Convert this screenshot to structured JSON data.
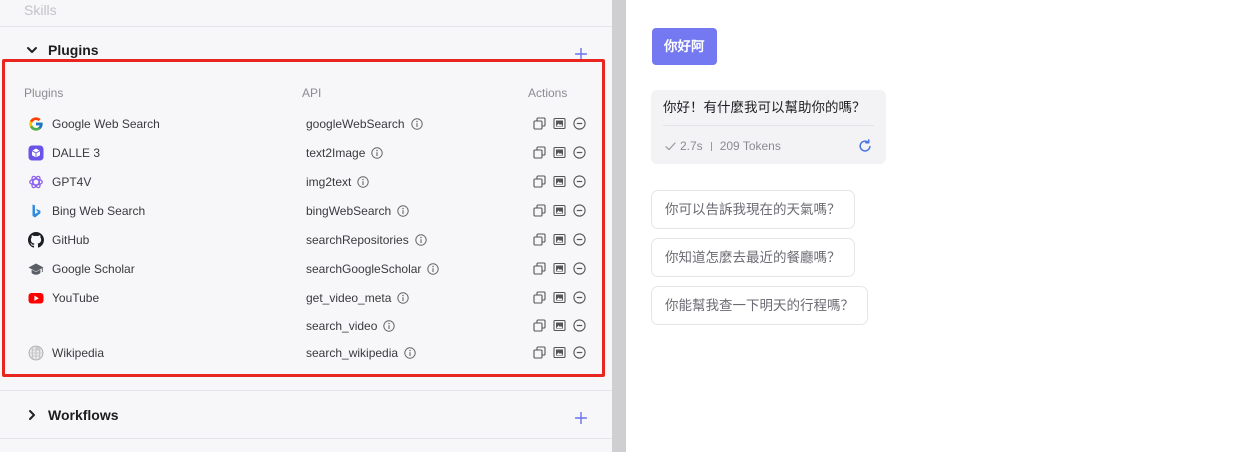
{
  "sidebar": {
    "skills_label": "Skills",
    "plugins": {
      "title": "Plugins",
      "headers": {
        "plugin": "Plugins",
        "api": "API",
        "actions": "Actions"
      },
      "rows": [
        {
          "plugin": "Google Web Search",
          "icon": "google-icon",
          "api": "googleWebSearch"
        },
        {
          "plugin": "DALLE 3",
          "icon": "dalle-icon",
          "api": "text2Image"
        },
        {
          "plugin": "GPT4V",
          "icon": "gpt4v-icon",
          "api": "img2text"
        },
        {
          "plugin": "Bing Web Search",
          "icon": "bing-icon",
          "api": "bingWebSearch"
        },
        {
          "plugin": "GitHub",
          "icon": "github-icon",
          "api": "searchRepositories"
        },
        {
          "plugin": "Google Scholar",
          "icon": "google-scholar-icon",
          "api": "searchGoogleScholar"
        },
        {
          "plugin": "YouTube",
          "icon": "youtube-icon",
          "api": "get_video_meta"
        },
        {
          "plugin": "",
          "icon": null,
          "api": "search_video"
        },
        {
          "plugin": "Wikipedia",
          "icon": "wikipedia-icon",
          "api": "search_wikipedia"
        }
      ],
      "row_action_icons": [
        "copy-icon",
        "image-icon",
        "remove-icon"
      ]
    },
    "workflows": {
      "title": "Workflows"
    }
  },
  "chat": {
    "user_message": "你好阿",
    "assistant_message": {
      "text": "你好！有什麼我可以幫助你的嗎？",
      "duration": "2.7s",
      "tokens": "209 Tokens"
    },
    "suggestions": [
      "你可以告訴我現在的天氣嗎？",
      "你知道怎麼去最近的餐廳嗎？",
      "你能幫我查一下明天的行程嗎？"
    ]
  },
  "colors": {
    "accent": "#7479f1",
    "highlight_border": "#e8261f",
    "regenerate_icon": "#4b73e6",
    "panel_background": "#f7f7f9"
  }
}
